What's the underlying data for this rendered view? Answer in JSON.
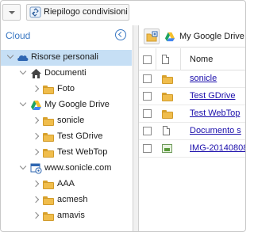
{
  "toolbar": {
    "summary_label": "Riepilogo condivisioni",
    "summary_icon": "share-link-icon",
    "dropdown_icon": "chevron-down-icon"
  },
  "sidebar": {
    "title": "Cloud",
    "collapse_icon": "chevron-left-circle-icon",
    "items": [
      {
        "label": "Risorse personali",
        "icon": "cloud-icon",
        "level": 0,
        "expanded": true,
        "selected": true
      },
      {
        "label": "Documenti",
        "icon": "home-icon",
        "level": 1,
        "expanded": true
      },
      {
        "label": "Foto",
        "icon": "folder-icon",
        "level": 2,
        "expanded": false
      },
      {
        "label": "My Google Drive",
        "icon": "google-drive-icon",
        "level": 1,
        "expanded": true
      },
      {
        "label": "sonicle",
        "icon": "folder-icon",
        "level": 2,
        "expanded": false
      },
      {
        "label": "Test GDrive",
        "icon": "folder-icon",
        "level": 2,
        "expanded": false
      },
      {
        "label": "Test WebTop",
        "icon": "folder-icon",
        "level": 2,
        "expanded": false
      },
      {
        "label": "www.sonicle.com",
        "icon": "ftp-server-icon",
        "level": 1,
        "expanded": true
      },
      {
        "label": "AAA",
        "icon": "folder-icon",
        "level": 2,
        "expanded": false
      },
      {
        "label": "acmesh",
        "icon": "folder-icon",
        "level": 2,
        "expanded": false
      },
      {
        "label": "amavis",
        "icon": "folder-icon",
        "level": 2,
        "expanded": false
      }
    ]
  },
  "main": {
    "breadcrumb": "My Google Drive",
    "breadcrumb_icon": "google-drive-icon",
    "new_button_icon": "new-folder-icon",
    "columns": {
      "name": "Nome"
    },
    "files": [
      {
        "name": "sonicle",
        "type": "folder"
      },
      {
        "name": "Test GDrive",
        "type": "folder"
      },
      {
        "name": "Test WebTop",
        "type": "folder"
      },
      {
        "name": "Documento s",
        "type": "document"
      },
      {
        "name": "IMG-20140808",
        "type": "image"
      }
    ]
  },
  "colors": {
    "accent": "#3a78c3",
    "selection": "#c6dff5",
    "link": "#1a0dab",
    "folder": "#f0bd4c"
  }
}
